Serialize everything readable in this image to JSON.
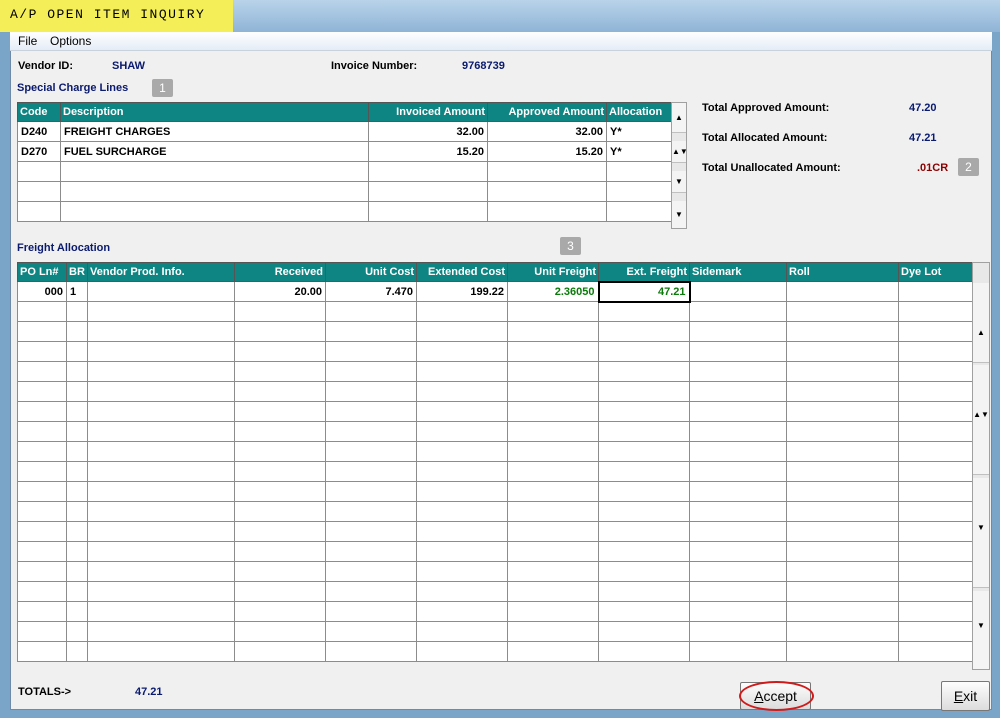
{
  "window": {
    "title": "A/P  OPEN ITEM INQUIRY"
  },
  "menu": [
    "File",
    "Options"
  ],
  "header": {
    "vendor_label": "Vendor ID:",
    "vendor_value": "SHAW",
    "invoice_label": "Invoice Number:",
    "invoice_value": "9768739"
  },
  "special": {
    "title": "Special Charge Lines",
    "badge": "1",
    "columns": [
      "Code",
      "Description",
      "Invoiced Amount",
      "Approved Amount",
      "Allocation"
    ],
    "rows": [
      [
        "D240",
        "FREIGHT CHARGES",
        "32.00",
        "32.00",
        "Y*"
      ],
      [
        "D270",
        "FUEL SURCHARGE",
        "15.20",
        "15.20",
        "Y*"
      ]
    ]
  },
  "totals_panel": {
    "approved_label": "Total Approved Amount:",
    "approved_value": "47.20",
    "allocated_label": "Total Allocated Amount:",
    "allocated_value": "47.21",
    "unallocated_label": "Total Unallocated Amount:",
    "unallocated_value": ".01CR",
    "badge": "2"
  },
  "freight": {
    "title": "Freight Allocation",
    "badge": "3",
    "columns": [
      "PO Ln#",
      "BR",
      "Vendor Prod. Info.",
      "Received",
      "Unit Cost",
      "Extended Cost",
      "Unit Freight",
      "Ext. Freight",
      "Sidemark",
      "Roll",
      "Dye Lot"
    ],
    "rows": [
      [
        "000",
        "1",
        "",
        "20.00",
        "7.470",
        "199.22",
        "2.36050",
        "47.21",
        "",
        "",
        ""
      ]
    ]
  },
  "footer": {
    "totals_label": "TOTALS->",
    "totals_value": "47.21",
    "accept_label": "Accept",
    "exit_label": "Exit"
  },
  "colors": {
    "highlight": "#f4ee58",
    "table_header": "#0f8583",
    "value_text": "#0a1a6e",
    "credit_text": "#8b0000",
    "freight_text": "#0a7a0a",
    "accept_circle": "#d11a1a"
  }
}
